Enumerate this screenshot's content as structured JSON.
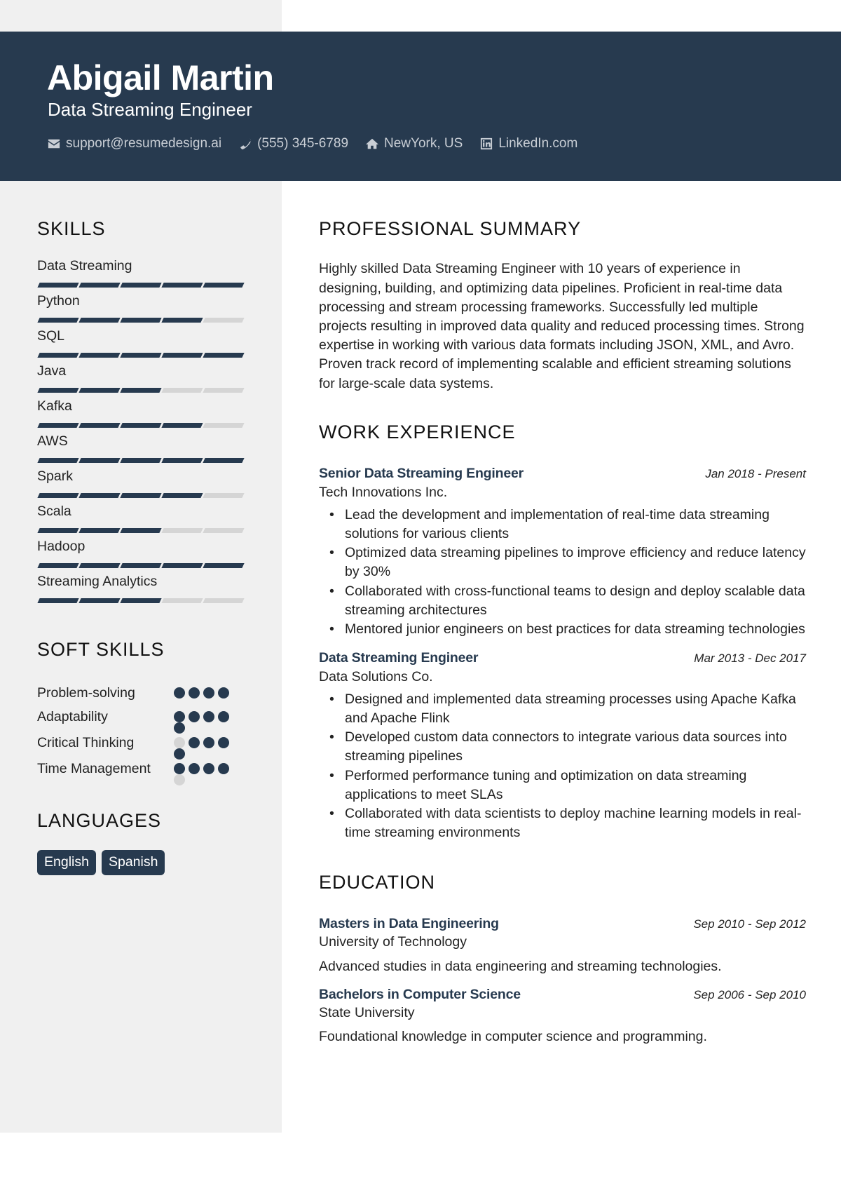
{
  "header": {
    "name": "Abigail Martin",
    "title": "Data Streaming Engineer",
    "contacts": [
      {
        "icon": "envelope-icon",
        "text": "support@resumedesign.ai"
      },
      {
        "icon": "phone-icon",
        "text": "(555) 345-6789"
      },
      {
        "icon": "home-icon",
        "text": "NewYork, US"
      },
      {
        "icon": "linkedin-icon",
        "text": "LinkedIn.com"
      }
    ]
  },
  "colors": {
    "accent": "#273a4f",
    "sidebar_bg": "#f0f0f0",
    "inactive": "#d5d5d5"
  },
  "skills": {
    "heading": "SKILLS",
    "max": 5,
    "items": [
      {
        "name": "Data Streaming",
        "level": 5
      },
      {
        "name": "Python",
        "level": 4
      },
      {
        "name": "SQL",
        "level": 5
      },
      {
        "name": "Java",
        "level": 3
      },
      {
        "name": "Kafka",
        "level": 4
      },
      {
        "name": "AWS",
        "level": 5
      },
      {
        "name": "Spark",
        "level": 4
      },
      {
        "name": "Scala",
        "level": 3
      },
      {
        "name": "Hadoop",
        "level": 5
      },
      {
        "name": "Streaming Analytics",
        "level": 3
      }
    ]
  },
  "soft_skills": {
    "heading": "SOFT SKILLS",
    "items": [
      {
        "name": "Problem-solving",
        "dots": [
          true,
          true,
          true,
          true
        ]
      },
      {
        "name": "Adaptability",
        "dots": [
          true,
          true,
          true,
          true,
          true
        ]
      },
      {
        "name": "Critical Thinking",
        "dots": [
          false,
          true,
          true,
          true,
          true
        ]
      },
      {
        "name": "Time Management",
        "dots": [
          true,
          true,
          true,
          true,
          false
        ]
      }
    ]
  },
  "languages": {
    "heading": "LANGUAGES",
    "items": [
      "English",
      "Spanish"
    ]
  },
  "summary": {
    "heading": "PROFESSIONAL SUMMARY",
    "text": "Highly skilled Data Streaming Engineer with 10 years of experience in designing, building, and optimizing data pipelines. Proficient in real-time data processing and stream processing frameworks. Successfully led multiple projects resulting in improved data quality and reduced processing times. Strong expertise in working with various data formats including JSON, XML, and Avro. Proven track record of implementing scalable and efficient streaming solutions for large-scale data systems."
  },
  "work": {
    "heading": "WORK EXPERIENCE",
    "jobs": [
      {
        "role": "Senior Data Streaming Engineer",
        "dates": "Jan 2018 - Present",
        "company": "Tech Innovations Inc.",
        "bullets": [
          "Lead the development and implementation of real-time data streaming solutions for various clients",
          "Optimized data streaming pipelines to improve efficiency and reduce latency by 30%",
          "Collaborated with cross-functional teams to design and deploy scalable data streaming architectures",
          "Mentored junior engineers on best practices for data streaming technologies"
        ]
      },
      {
        "role": "Data Streaming Engineer",
        "dates": "Mar 2013 - Dec 2017",
        "company": "Data Solutions Co.",
        "bullets": [
          "Designed and implemented data streaming processes using Apache Kafka and Apache Flink",
          "Developed custom data connectors to integrate various data sources into streaming pipelines",
          "Performed performance tuning and optimization on data streaming applications to meet SLAs",
          "Collaborated with data scientists to deploy machine learning models in real-time streaming environments"
        ]
      }
    ]
  },
  "education": {
    "heading": "EDUCATION",
    "items": [
      {
        "degree": "Masters in Data Engineering",
        "dates": "Sep 2010 - Sep 2012",
        "school": "University of Technology",
        "desc": "Advanced studies in data engineering and streaming technologies."
      },
      {
        "degree": "Bachelors in Computer Science",
        "dates": "Sep 2006 - Sep 2010",
        "school": "State University",
        "desc": "Foundational knowledge in computer science and programming."
      }
    ]
  }
}
